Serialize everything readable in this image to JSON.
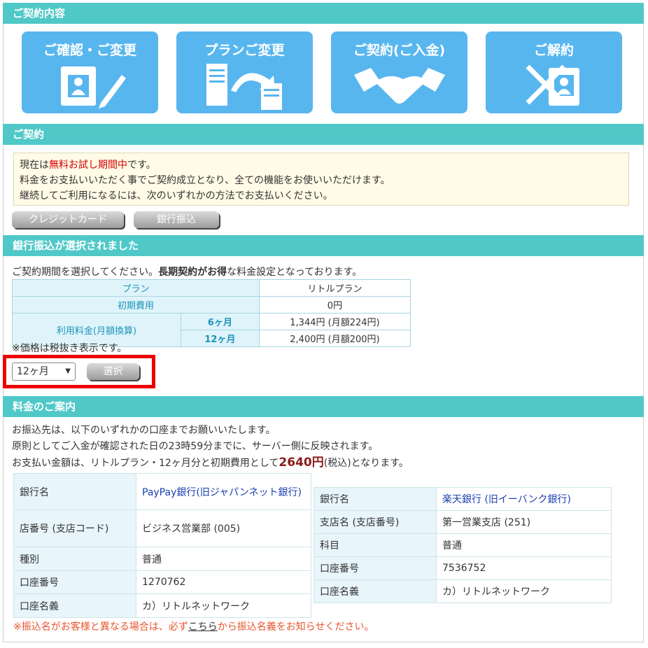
{
  "sections": {
    "contract": "ご契約内容",
    "keiyaku": "ご契約",
    "bank_selected": "銀行振込が選択されました",
    "fee_guide": "料金のご案内"
  },
  "tiles": [
    {
      "label": "ご確認・ご変更",
      "icon": "contract-check-icon"
    },
    {
      "label": "プランご変更",
      "icon": "server-transfer-icon"
    },
    {
      "label": "ご契約(ご入金)",
      "icon": "handshake-icon"
    },
    {
      "label": "ご解約",
      "icon": "cancel-contract-icon"
    }
  ],
  "notice": {
    "l1_a": "現在は",
    "l1_red": "無料お試し期間中",
    "l1_b": "です。",
    "l2": "料金をお支払いいただく事でご契約成立となり、全ての機能をお使いいただけます。",
    "l3": "継続してご利用になるには、次のいずれかの方法でお支払いください。"
  },
  "payment_buttons": {
    "credit": "クレジットカード",
    "bank": "銀行振込"
  },
  "period_prompt": {
    "a": "ご契約期間を選択してください。",
    "bold": "長期契約がお得",
    "b": "な料金設定となっております。"
  },
  "plan_table": {
    "plan_h": "プラン",
    "plan_v": "リトルプラン",
    "init_h": "初期費用",
    "init_v": "0円",
    "fee_h": "利用料金(月額換算)",
    "m6": "6ヶ月",
    "m6_v": "1,344円 (月額224円)",
    "m12": "12ヶ月",
    "m12_v": "2,400円 (月額200円)"
  },
  "tax_note": "※価格は税抜き表示です。",
  "period_select": {
    "value": "12ヶ月"
  },
  "select_button": "選択",
  "guide": {
    "l1": "お振込先は、以下のいずれかの口座までお願いいたします。",
    "l2": "原則としてご入金が確認された日の23時59分までに、サーバー側に反映されます。",
    "l3_a": "お支払い金額は、リトルプラン・12ヶ月分と初期費用として",
    "l3_amt": "2640円",
    "l3_b": "(税込)となります。"
  },
  "bank1": [
    {
      "k": "銀行名",
      "v": "PayPay銀行(旧ジャパンネット銀行)"
    },
    {
      "k": "店番号 (支店コード)",
      "v": "ビジネス営業部 (005)"
    },
    {
      "k": "種別",
      "v": "普通"
    },
    {
      "k": "口座番号",
      "v": "1270762"
    },
    {
      "k": "口座名義",
      "v": "カ）リトルネットワーク"
    }
  ],
  "bank2": [
    {
      "k": "銀行名",
      "v": "楽天銀行 (旧イーバンク銀行)"
    },
    {
      "k": "支店名 (支店番号)",
      "v": "第一営業支店 (251)"
    },
    {
      "k": "科目",
      "v": "普通"
    },
    {
      "k": "口座番号",
      "v": "7536752"
    },
    {
      "k": "口座名義",
      "v": "カ）リトルネットワーク"
    }
  ],
  "warning": {
    "a": "※振込名がお客様と異なる場合は、必ず",
    "link": "こちら",
    "b": "から振込名義をお知らせください。"
  }
}
